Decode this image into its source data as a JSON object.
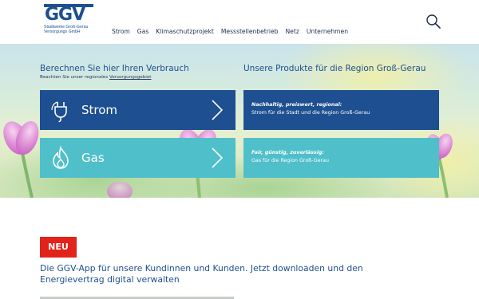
{
  "header": {
    "logo_text": "GGV",
    "logo_sub_line1": "Stadtwerke Groß-Gerau",
    "logo_sub_line2": "Versorgungs GmbH",
    "nav": [
      "Strom",
      "Gas",
      "Klimaschutzprojekt",
      "Messstellenbetrieb",
      "Netz",
      "Unternehmen"
    ],
    "search_icon": "search-icon"
  },
  "hero": {
    "left_title": "Berechnen Sie hier Ihren Verbrauch",
    "left_sub_prefix": "Beachten Sie unser regionales ",
    "left_sub_link": "Versorgungsgebiet",
    "tiles": [
      {
        "label": "Strom",
        "icon": "plug-icon"
      },
      {
        "label": "Gas",
        "icon": "flame-icon"
      }
    ],
    "right_title": "Unsere Produkte für die Region Groß-Gerau",
    "products": [
      {
        "tag": "Nachhaltig, preiswert, regional:",
        "desc": "Strom für die Stadt und die Region Groß-Gerau"
      },
      {
        "tag": "Fair, günstig, zuverlässig:",
        "desc": "Gas für die Region Groß-Gerau"
      }
    ]
  },
  "news": {
    "badge": "NEU",
    "text": "Die GGV-App für unsere Kundinnen und Kunden. Jetzt downloaden und den Energievertrag digital verwalten"
  },
  "colors": {
    "brand_blue": "#1d4f91",
    "turquoise": "#4fbfca",
    "badge_red": "#e2231a"
  }
}
